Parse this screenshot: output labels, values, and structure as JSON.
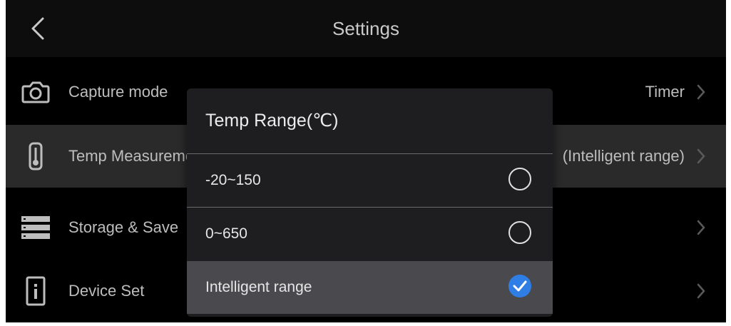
{
  "header": {
    "title": "Settings"
  },
  "rows": [
    {
      "label": "Capture mode",
      "value": "Timer",
      "icon": "camera-icon"
    },
    {
      "label": "Temp Measurement",
      "value": "(Intelligent range)",
      "icon": "thermometer-icon"
    },
    {
      "label": "Storage & Save",
      "value": "",
      "icon": "storage-icon"
    },
    {
      "label": "Device Set",
      "value": "",
      "icon": "device-info-icon"
    }
  ],
  "dialog": {
    "title": "Temp Range(℃)",
    "options": [
      {
        "label": "-20~150",
        "selected": false
      },
      {
        "label": "0~650",
        "selected": false
      },
      {
        "label": "Intelligent range",
        "selected": true
      }
    ]
  },
  "colors": {
    "accent": "#2e7ee6",
    "background": "#000000",
    "highlight_row": "#2a2a2a",
    "dialog_bg": "#1e1e20",
    "selected_option_bg": "#4a4a4e"
  }
}
